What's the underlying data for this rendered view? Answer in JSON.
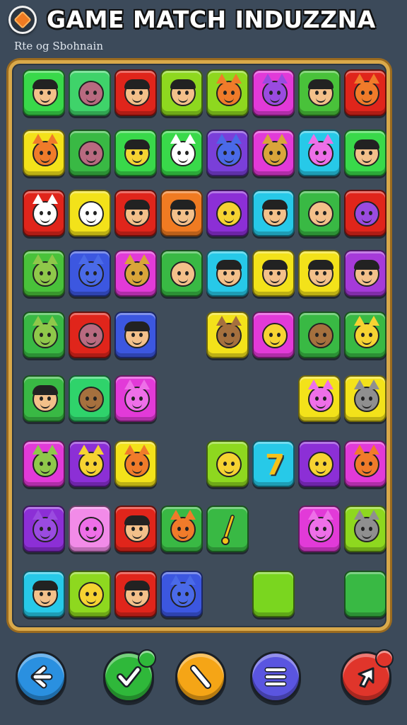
{
  "header": {
    "title": "GAME MATCH INDUZZNA",
    "subtitle": "Rte og Sbohnain",
    "logo_icon": "orange-diamond-icon"
  },
  "colors": {
    "background": "#3c4a5a",
    "board_border": "#d9a94a",
    "tile_green": "#39d94a",
    "tile_red": "#e0251b",
    "tile_magenta": "#e23ad8",
    "tile_purple": "#8c2fd6",
    "tile_yellow": "#f3e21a",
    "tile_cyan": "#27c9e8",
    "tile_blue": "#3c57e0",
    "tile_lime": "#8ed81f",
    "tile_orange": "#f07b22",
    "tile_pink": "#f28be8"
  },
  "board": {
    "columns": 8,
    "rows": [
      [
        {
          "color": "#39d94a",
          "icon": "boy-face-icon"
        },
        {
          "color": "#3fd36a",
          "icon": "onion-creature-icon"
        },
        {
          "color": "#e0251b",
          "icon": "boy-face-icon"
        },
        {
          "color": "#8ed81f",
          "icon": "boy-face-icon"
        },
        {
          "color": "#8ed81f",
          "icon": "orange-cat-icon"
        },
        {
          "color": "#e23ad8",
          "icon": "purple-cat-icon"
        },
        {
          "color": "#49c23a",
          "icon": "boy-face-icon"
        },
        {
          "color": "#e0251b",
          "icon": "red-cat-icon"
        }
      ],
      [
        {
          "color": "#f3e21a",
          "icon": "orange-tabby-cat-icon"
        },
        {
          "color": "#39b944",
          "icon": "onion-creature-icon"
        },
        {
          "color": "#39d94a",
          "icon": "yellow-boy-face-icon"
        },
        {
          "color": "#39d94a",
          "icon": "white-cat-icon"
        },
        {
          "color": "#7a3fd9",
          "icon": "blue-cat-icon"
        },
        {
          "color": "#e23ad8",
          "icon": "owl-cat-icon"
        },
        {
          "color": "#27c9e8",
          "icon": "pink-cat-icon"
        },
        {
          "color": "#39d94a",
          "icon": "boy-face-icon"
        }
      ],
      [
        {
          "color": "#e0251b",
          "icon": "white-cat-icon"
        },
        {
          "color": "#f3e21a",
          "icon": "white-onion-icon"
        },
        {
          "color": "#e0251b",
          "icon": "boy-face-icon"
        },
        {
          "color": "#f07b22",
          "icon": "boy-face-icon"
        },
        {
          "color": "#8c2fd6",
          "icon": "yellow-onion-icon"
        },
        {
          "color": "#27c9e8",
          "icon": "boy-face-icon"
        },
        {
          "color": "#39b944",
          "icon": "pineapple-creature-icon"
        },
        {
          "color": "#e0251b",
          "icon": "purple-creature-icon"
        }
      ],
      [
        {
          "color": "#49c23a",
          "icon": "green-cat-icon"
        },
        {
          "color": "#3c57e0",
          "icon": "blue-cat-icon"
        },
        {
          "color": "#e23ad8",
          "icon": "owl-cat-icon"
        },
        {
          "color": "#39b944",
          "icon": "bald-face-icon"
        },
        {
          "color": "#27c9e8",
          "icon": "boy-face-icon"
        },
        {
          "color": "#f3e21a",
          "icon": "boy-face-icon"
        },
        {
          "color": "#f3e21a",
          "icon": "boy-face-icon"
        },
        {
          "color": "#a63ad9",
          "icon": "boy-face-icon"
        }
      ],
      [
        {
          "color": "#39b944",
          "icon": "green-cat-icon"
        },
        {
          "color": "#e0251b",
          "icon": "onion-creature-icon"
        },
        {
          "color": "#3c57e0",
          "icon": "boy-face-icon"
        },
        null,
        {
          "color": "#f3e21a",
          "icon": "brown-cat-icon"
        },
        {
          "color": "#e23ad8",
          "icon": "yellow-fire-face-icon"
        },
        {
          "color": "#39b944",
          "icon": "dark-onion-icon"
        },
        {
          "color": "#39b944",
          "icon": "yellow-cat-icon"
        }
      ],
      [
        {
          "color": "#39b944",
          "icon": "boy-face-icon"
        },
        {
          "color": "#2fd36b",
          "icon": "brown-onion-icon"
        },
        {
          "color": "#e23ad8",
          "icon": "pink-cat-icon"
        },
        null,
        null,
        null,
        {
          "color": "#f3e21a",
          "icon": "magenta-cat-icon"
        },
        {
          "color": "#f3e21a",
          "icon": "grey-cat-icon"
        }
      ],
      [
        {
          "color": "#e23ad8",
          "icon": "lime-cat-icon"
        },
        {
          "color": "#8c2fd6",
          "icon": "yellow-cat-icon"
        },
        {
          "color": "#f3e21a",
          "icon": "orange-fox-icon"
        },
        null,
        {
          "color": "#8ed81f",
          "icon": "star-creature-icon"
        },
        {
          "color": "#27c9e8",
          "icon": "number-seven-icon",
          "text": "7"
        },
        {
          "color": "#8c2fd6",
          "icon": "star-creature-icon"
        },
        {
          "color": "#e23ad8",
          "icon": "orange-cat-icon"
        }
      ],
      [
        {
          "color": "#8c2fd6",
          "icon": "purple-cat-icon"
        },
        {
          "color": "#f28be8",
          "icon": "pink-onion-icon"
        },
        {
          "color": "#e0251b",
          "icon": "boy-face-icon"
        },
        {
          "color": "#39b944",
          "icon": "orange-cat-icon"
        },
        {
          "color": "#39b944",
          "icon": "pin-icon"
        },
        null,
        {
          "color": "#e23ad8",
          "icon": "pink-cat-icon"
        },
        {
          "color": "#8ed81f",
          "icon": "wolf-icon"
        }
      ],
      [
        {
          "color": "#27c9e8",
          "icon": "boy-face-icon"
        },
        {
          "color": "#8ed81f",
          "icon": "yellow-onion-icon"
        },
        {
          "color": "#e0251b",
          "icon": "boy-face-icon"
        },
        {
          "color": "#3c57e0",
          "icon": "blue-cat-icon"
        },
        null,
        {
          "color": "#7ad61f",
          "icon": "blank-tile"
        },
        null,
        {
          "color": "#39b944",
          "icon": "blank-tile"
        }
      ]
    ]
  },
  "toolbar": [
    {
      "name": "back-button",
      "icon": "arrow-left-icon",
      "color": "#2a90e0"
    },
    {
      "name": "confirm-button",
      "icon": "checkmark-icon",
      "color": "#2fb83a",
      "badge": "#2fb83a"
    },
    {
      "name": "hint-button",
      "icon": "pencil-icon",
      "color": "#f5a516"
    },
    {
      "name": "menu-button",
      "icon": "list-icon",
      "color": "#5a55e0"
    },
    {
      "name": "shuffle-button",
      "icon": "cursor-arrow-icon",
      "color": "#e0352b",
      "badge": "#e0352b"
    }
  ]
}
